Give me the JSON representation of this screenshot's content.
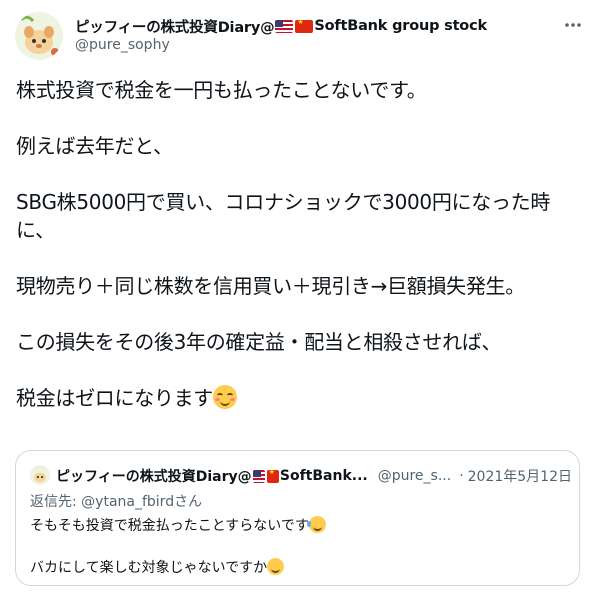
{
  "author": {
    "name": "ピッフィーの株式投資Diary@",
    "name_suffix": "SoftBank group stock",
    "handle": "@pure_sophy",
    "flags": [
      "us-flag",
      "cn-flag"
    ]
  },
  "tweet": {
    "lines": [
      "株式投資で税金を一円も払ったことないです。",
      "例えば去年だと、",
      "SBG株5000円で買い、コロナショックで3000円になった時に、",
      "現物売り＋同じ株数を信用買い＋現引き→巨額損失発生。",
      "この損失をその後3年の確定益・配当と相殺させれば、",
      "税金はゼロになります"
    ],
    "emoji": "smiling-face-with-smiling-eyes"
  },
  "quoted_tweet": {
    "name": "ピッフィーの株式投資Diary@",
    "name_suffix": "SoftBank...",
    "handle": "@pure_s...",
    "date": "2021年5月12日",
    "reply_prefix": "返信先: ",
    "reply_handle": "@ytana_fbird",
    "reply_suffix": "さん",
    "line1": "そもそも投資で税金払ったことすらないです",
    "line2": "バカにして楽しむ対象じゃないですか"
  },
  "icons": [
    "more-icon"
  ],
  "colors": {
    "text": "#0f1419",
    "secondary": "#536471",
    "border": "#cfd9de"
  }
}
